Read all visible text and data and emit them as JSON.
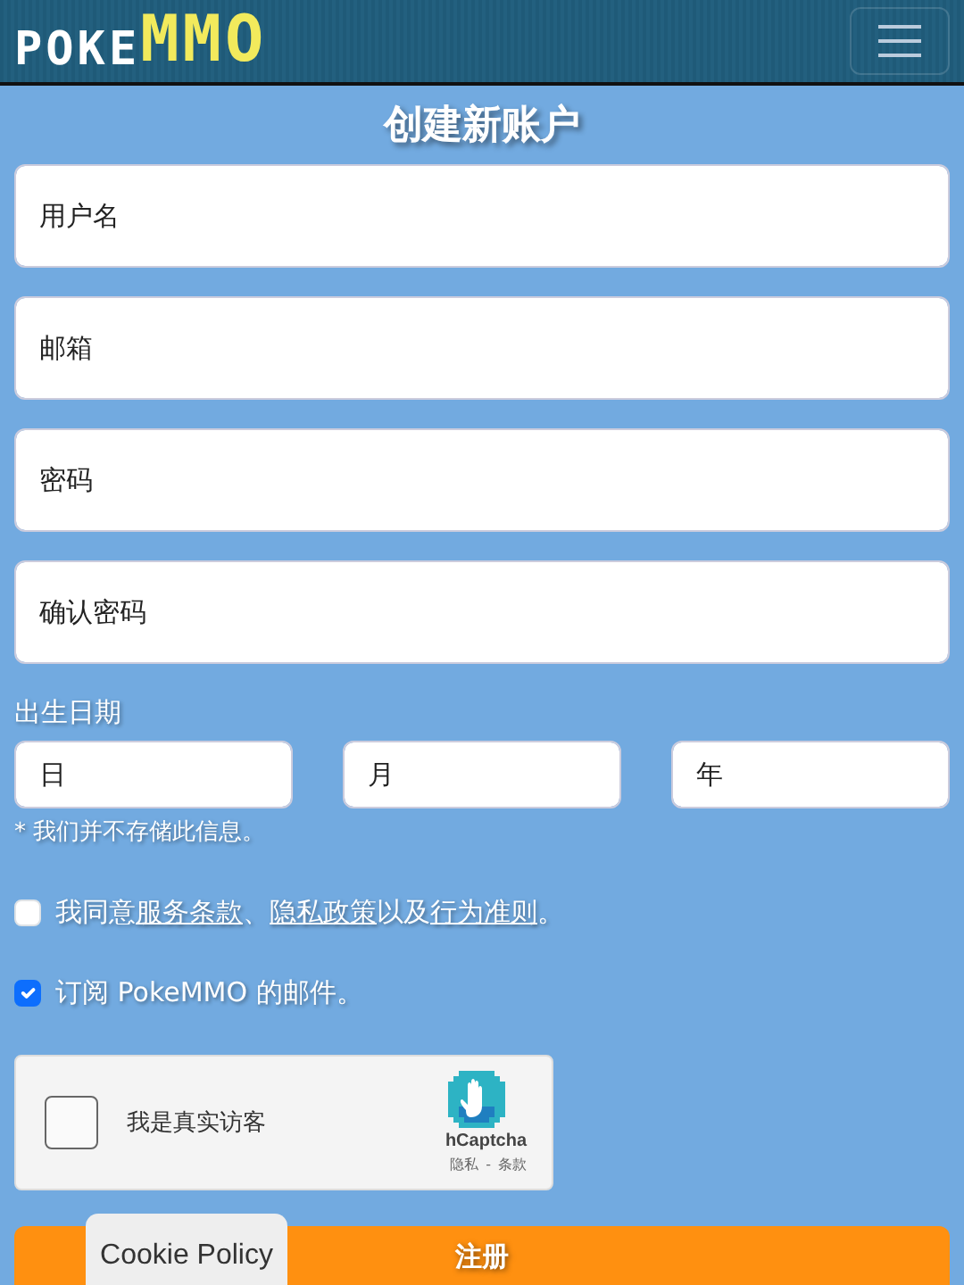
{
  "navbar": {
    "logo": [
      {
        "text": "POKE",
        "kind": "plain"
      },
      {
        "text": "MMO",
        "kind": "accent"
      }
    ]
  },
  "title": "创建新账户",
  "fields": [
    {
      "placeholder": "用户名"
    },
    {
      "placeholder": "邮箱"
    },
    {
      "placeholder": "密码"
    },
    {
      "placeholder": "确认密码"
    }
  ],
  "birth_date": {
    "label": "出生日期",
    "fields": [
      {
        "placeholder": "日"
      },
      {
        "placeholder": "月"
      },
      {
        "placeholder": "年"
      }
    ],
    "note": "* 我们并不存储此信息。"
  },
  "checkboxes": [
    {
      "checked": false,
      "parts": [
        {
          "kind": "text",
          "text": "我同意"
        },
        {
          "kind": "link",
          "text": "服务条款"
        },
        {
          "kind": "text",
          "text": "、"
        },
        {
          "kind": "link",
          "text": "隐私政策"
        },
        {
          "kind": "text",
          "text": "以及"
        },
        {
          "kind": "link",
          "text": "行为准则"
        },
        {
          "kind": "text",
          "text": "。"
        }
      ]
    },
    {
      "checked": true,
      "parts": [
        {
          "kind": "text",
          "text": "订阅 PokeMMO 的邮件。"
        }
      ]
    }
  ],
  "captcha": {
    "checked": false,
    "label": "我是真实访客",
    "brand": "hCaptcha",
    "links": [
      "隐私",
      "条款"
    ],
    "separator": "-"
  },
  "submit": "注册",
  "cookie_tab": "Cookie Policy"
}
